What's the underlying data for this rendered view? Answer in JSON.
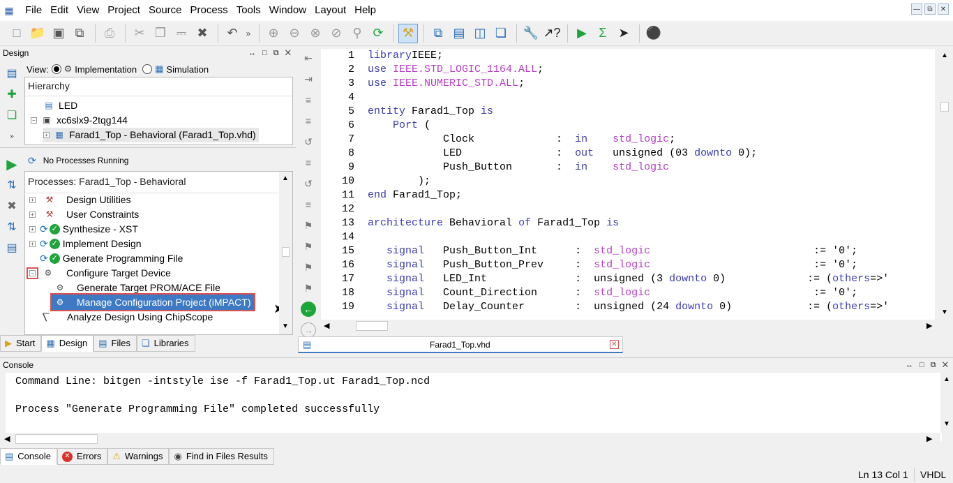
{
  "menu": [
    "File",
    "Edit",
    "View",
    "Project",
    "Source",
    "Process",
    "Tools",
    "Window",
    "Layout",
    "Help"
  ],
  "design": {
    "header": "Design",
    "view_label": "View:",
    "view_options": [
      "Implementation",
      "Simulation"
    ],
    "hierarchy_header": "Hierarchy",
    "hierarchy": [
      "LED",
      "xc6slx9-2tqg144",
      "Farad1_Top - Behavioral (Farad1_Top.vhd)"
    ],
    "process_status": "No Processes Running",
    "processes_header": "Processes: Farad1_Top - Behavioral",
    "processes": [
      "Design Utilities",
      "User Constraints",
      "Synthesize - XST",
      "Implement Design",
      "Generate Programming File",
      "Configure Target Device",
      "Generate Target PROM/ACE File",
      "Manage Configuration Project (iMPACT)",
      "Analyze Design Using ChipScope"
    ]
  },
  "left_tabs": [
    "Start",
    "Design",
    "Files",
    "Libraries"
  ],
  "editor": {
    "file_tab": "Farad1_Top.vhd",
    "lines": [
      {
        "n": "1",
        "t": [
          [
            "kw",
            "library"
          ],
          [
            "",
            "IEEE;"
          ]
        ]
      },
      {
        "n": "2",
        "t": [
          [
            "kw",
            "use"
          ],
          [
            "",
            " "
          ],
          [
            "ty",
            "IEEE.STD_LOGIC_1164.ALL"
          ],
          [
            "",
            ";"
          ]
        ]
      },
      {
        "n": "3",
        "t": [
          [
            "kw",
            "use"
          ],
          [
            "",
            " "
          ],
          [
            "ty",
            "IEEE.NUMERIC_STD.ALL"
          ],
          [
            "",
            ";"
          ]
        ]
      },
      {
        "n": "4",
        "t": []
      },
      {
        "n": "5",
        "t": [
          [
            "kw",
            "entity"
          ],
          [
            "",
            " Farad1_Top "
          ],
          [
            "kw",
            "is"
          ]
        ]
      },
      {
        "n": "6",
        "t": [
          [
            "",
            "    "
          ],
          [
            "kw",
            "Port"
          ],
          [
            "",
            " ("
          ]
        ]
      },
      {
        "n": "7",
        "t": [
          [
            "",
            "            Clock             :  "
          ],
          [
            "kw",
            "in"
          ],
          [
            "",
            "    "
          ],
          [
            "ty",
            "std_logic"
          ],
          [
            "",
            ";"
          ]
        ]
      },
      {
        "n": "8",
        "t": [
          [
            "",
            "            LED               :  "
          ],
          [
            "kw",
            "out"
          ],
          [
            "",
            "   unsigned (03 "
          ],
          [
            "kw",
            "downto"
          ],
          [
            "",
            " 0);"
          ]
        ]
      },
      {
        "n": "9",
        "t": [
          [
            "",
            "            Push_Button       :  "
          ],
          [
            "kw",
            "in"
          ],
          [
            "",
            "    "
          ],
          [
            "ty",
            "std_logic"
          ]
        ]
      },
      {
        "n": "10",
        "t": [
          [
            "",
            "        );"
          ]
        ]
      },
      {
        "n": "11",
        "t": [
          [
            "kw",
            "end"
          ],
          [
            "",
            " Farad1_Top;"
          ]
        ]
      },
      {
        "n": "12",
        "t": []
      },
      {
        "n": "13",
        "t": [
          [
            "kw",
            "architecture"
          ],
          [
            "",
            " Behavioral "
          ],
          [
            "kw",
            "of"
          ],
          [
            "",
            " Farad1_Top "
          ],
          [
            "kw",
            "is"
          ]
        ]
      },
      {
        "n": "14",
        "t": []
      },
      {
        "n": "15",
        "t": [
          [
            "",
            "   "
          ],
          [
            "kw",
            "signal"
          ],
          [
            "",
            "   Push_Button_Int      :  "
          ],
          [
            "ty",
            "std_logic"
          ],
          [
            "",
            "                          := '0';"
          ]
        ]
      },
      {
        "n": "16",
        "t": [
          [
            "",
            "   "
          ],
          [
            "kw",
            "signal"
          ],
          [
            "",
            "   Push_Button_Prev     :  "
          ],
          [
            "ty",
            "std_logic"
          ],
          [
            "",
            "                          := '0';"
          ]
        ]
      },
      {
        "n": "17",
        "t": [
          [
            "",
            "   "
          ],
          [
            "kw",
            "signal"
          ],
          [
            "",
            "   LED_Int              :  unsigned (3 "
          ],
          [
            "kw",
            "downto"
          ],
          [
            "",
            " 0)             := ("
          ],
          [
            "kw",
            "others"
          ],
          [
            "",
            "=>'"
          ]
        ]
      },
      {
        "n": "18",
        "t": [
          [
            "",
            "   "
          ],
          [
            "kw",
            "signal"
          ],
          [
            "",
            "   Count_Direction      :  "
          ],
          [
            "ty",
            "std_logic"
          ],
          [
            "",
            "                          := '0';"
          ]
        ]
      },
      {
        "n": "19",
        "t": [
          [
            "",
            "   "
          ],
          [
            "kw",
            "signal"
          ],
          [
            "",
            "   Delay_Counter        :  unsigned (24 "
          ],
          [
            "kw",
            "downto"
          ],
          [
            "",
            " 0)            := ("
          ],
          [
            "kw",
            "others"
          ],
          [
            "",
            "=>'"
          ]
        ]
      }
    ]
  },
  "console": {
    "header": "Console",
    "lines": [
      "Command Line: bitgen -intstyle ise -f Farad1_Top.ut Farad1_Top.ncd",
      "",
      "Process \"Generate Programming File\" completed successfully"
    ]
  },
  "console_tabs": [
    "Console",
    "Errors",
    "Warnings",
    "Find in Files Results"
  ],
  "status": {
    "position": "Ln 13 Col 1",
    "language": "VHDL"
  }
}
